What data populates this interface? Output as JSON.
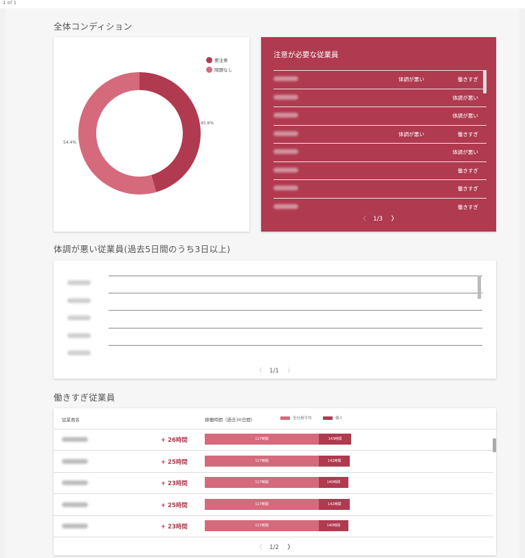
{
  "header": {
    "tiny_text": "1 of 1"
  },
  "overall": {
    "title": "全体コンディション",
    "legend": [
      {
        "label": "要注意",
        "color": "#b03a50"
      },
      {
        "label": "問題なし",
        "color": "#d56a7d"
      }
    ],
    "chart_data": {
      "type": "pie",
      "categories": [
        "要注意",
        "問題なし"
      ],
      "values": [
        45.6,
        54.4
      ],
      "labels": [
        "45.6%",
        "54.4%"
      ]
    }
  },
  "attention": {
    "title": "注意が必要な従業員",
    "rows": [
      {
        "tag1": "体調が悪い",
        "tag2": "働きすぎ"
      },
      {
        "tag1": "",
        "tag2": "体調が悪い"
      },
      {
        "tag1": "",
        "tag2": "体調が悪い"
      },
      {
        "tag1": "体調が悪い",
        "tag2": "働きすぎ"
      },
      {
        "tag1": "",
        "tag2": "体調が悪い"
      },
      {
        "tag1": "",
        "tag2": "働きすぎ"
      },
      {
        "tag1": "",
        "tag2": "働きすぎ"
      },
      {
        "tag1": "",
        "tag2": "働きすぎ"
      }
    ],
    "pager": {
      "prev": "〈",
      "page": "1/3",
      "next": "〉"
    }
  },
  "sick": {
    "title": "体調が悪い従業員(過去5日間のうち3日以上)",
    "row_count": 5,
    "pager": {
      "prev": "〈",
      "page": "1/1",
      "next": "〉"
    }
  },
  "overwork": {
    "title": "働きすぎ従業員",
    "col_name": "従業員名",
    "col_hours": "稼働時間（過去30日間）",
    "legend_avg": "全社員平均",
    "legend_ind": "個人",
    "color_avg": "#d56a7d",
    "color_ind": "#b03a50",
    "rows": [
      {
        "diff": "+ 26時間",
        "avg": "117時間",
        "ind": "143時間",
        "avg_h": 117,
        "ind_h": 143
      },
      {
        "diff": "+ 25時間",
        "avg": "117時間",
        "ind": "142時間",
        "avg_h": 117,
        "ind_h": 142
      },
      {
        "diff": "+ 23時間",
        "avg": "117時間",
        "ind": "140時間",
        "avg_h": 117,
        "ind_h": 140
      },
      {
        "diff": "+ 25時間",
        "avg": "117時間",
        "ind": "142時間",
        "avg_h": 117,
        "ind_h": 142
      },
      {
        "diff": "+ 23時間",
        "avg": "117時間",
        "ind": "140時間",
        "avg_h": 117,
        "ind_h": 140
      }
    ],
    "pager": {
      "prev": "〈",
      "page": "1/2",
      "next": "〉"
    }
  }
}
